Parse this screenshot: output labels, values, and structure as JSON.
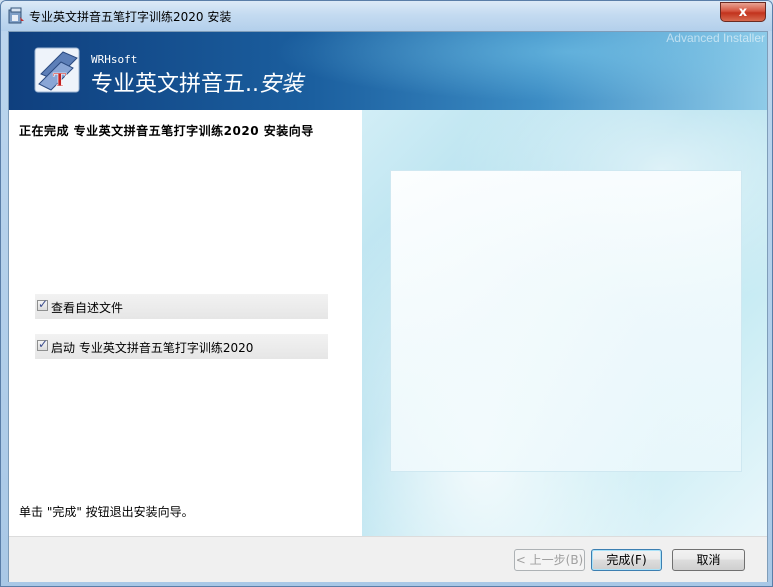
{
  "window": {
    "title": "专业英文拼音五笔打字训练2020 安装",
    "close_label": "x"
  },
  "banner": {
    "company": "WRHsoft",
    "product_main": "专业英文拼音五..",
    "product_tail": "安装",
    "brand": "Advanced Installer"
  },
  "content": {
    "heading": "正在完成 专业英文拼音五笔打字训练2020 安装向导",
    "checkboxes": [
      {
        "label": "查看自述文件",
        "checked": true
      },
      {
        "label": "启动 专业英文拼音五笔打字训练2020",
        "checked": true
      }
    ],
    "footer_note": "单击 \"完成\" 按钮退出安装向导。"
  },
  "buttons": {
    "back": "< 上一步(B)",
    "finish": "完成(F)",
    "cancel": "取消"
  },
  "colors": {
    "accent": "#3c7fb1",
    "banner_dark": "#0f3f7e",
    "close_red": "#c2331d"
  }
}
